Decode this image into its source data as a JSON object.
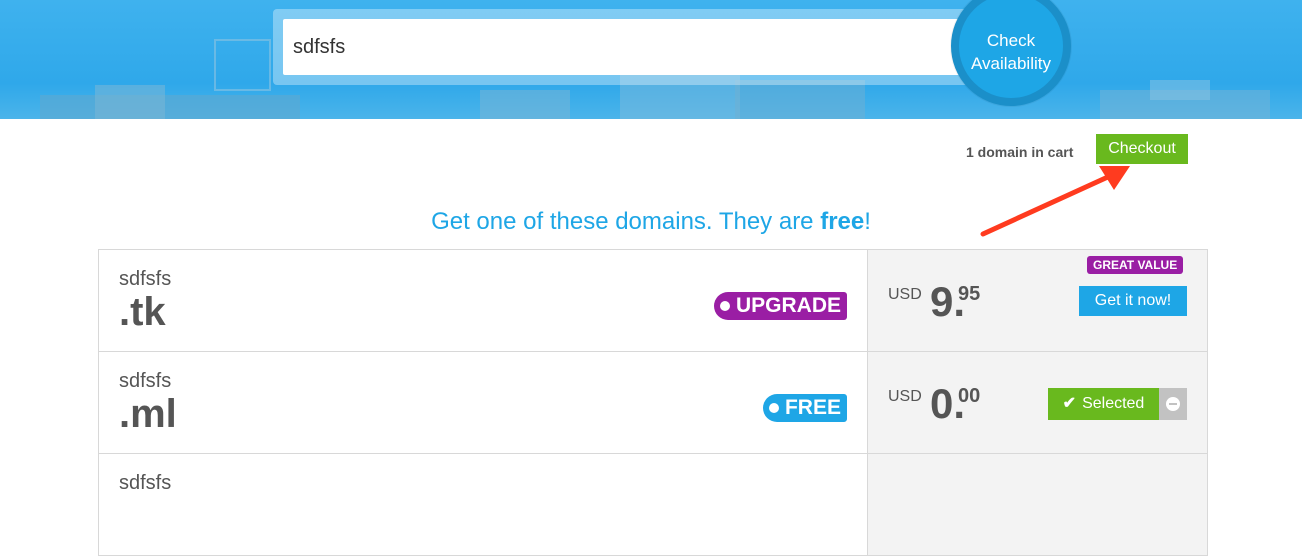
{
  "search": {
    "value": "sdfsfs",
    "button_label": "Check Availability"
  },
  "cart": {
    "count_text": "1 domain in cart",
    "checkout_label": "Checkout"
  },
  "heading": {
    "prefix": "Get one of these domains. They are ",
    "emphasis": "free",
    "suffix": "!"
  },
  "domains": [
    {
      "name": "sdfsfs",
      "tld": ".tk",
      "badge": "UPGRADE",
      "badge_color": "#9a1ea4",
      "currency": "USD",
      "price_main": "9.",
      "price_cents": "95",
      "tag": "GREAT VALUE",
      "action_label": "Get it now!"
    },
    {
      "name": "sdfsfs",
      "tld": ".ml",
      "badge": "FREE",
      "badge_color": "#1ea6e6",
      "currency": "USD",
      "price_main": "0.",
      "price_cents": "00",
      "action_label": "Selected",
      "action_icon": "checkmark-icon",
      "remove_icon": "minus-circle-icon"
    },
    {
      "name": "sdfsfs"
    }
  ],
  "colors": {
    "brand_blue": "#1ea6e6",
    "green": "#69b91e",
    "purple": "#9a1ea4",
    "annotation_red": "#ff3b1f"
  }
}
